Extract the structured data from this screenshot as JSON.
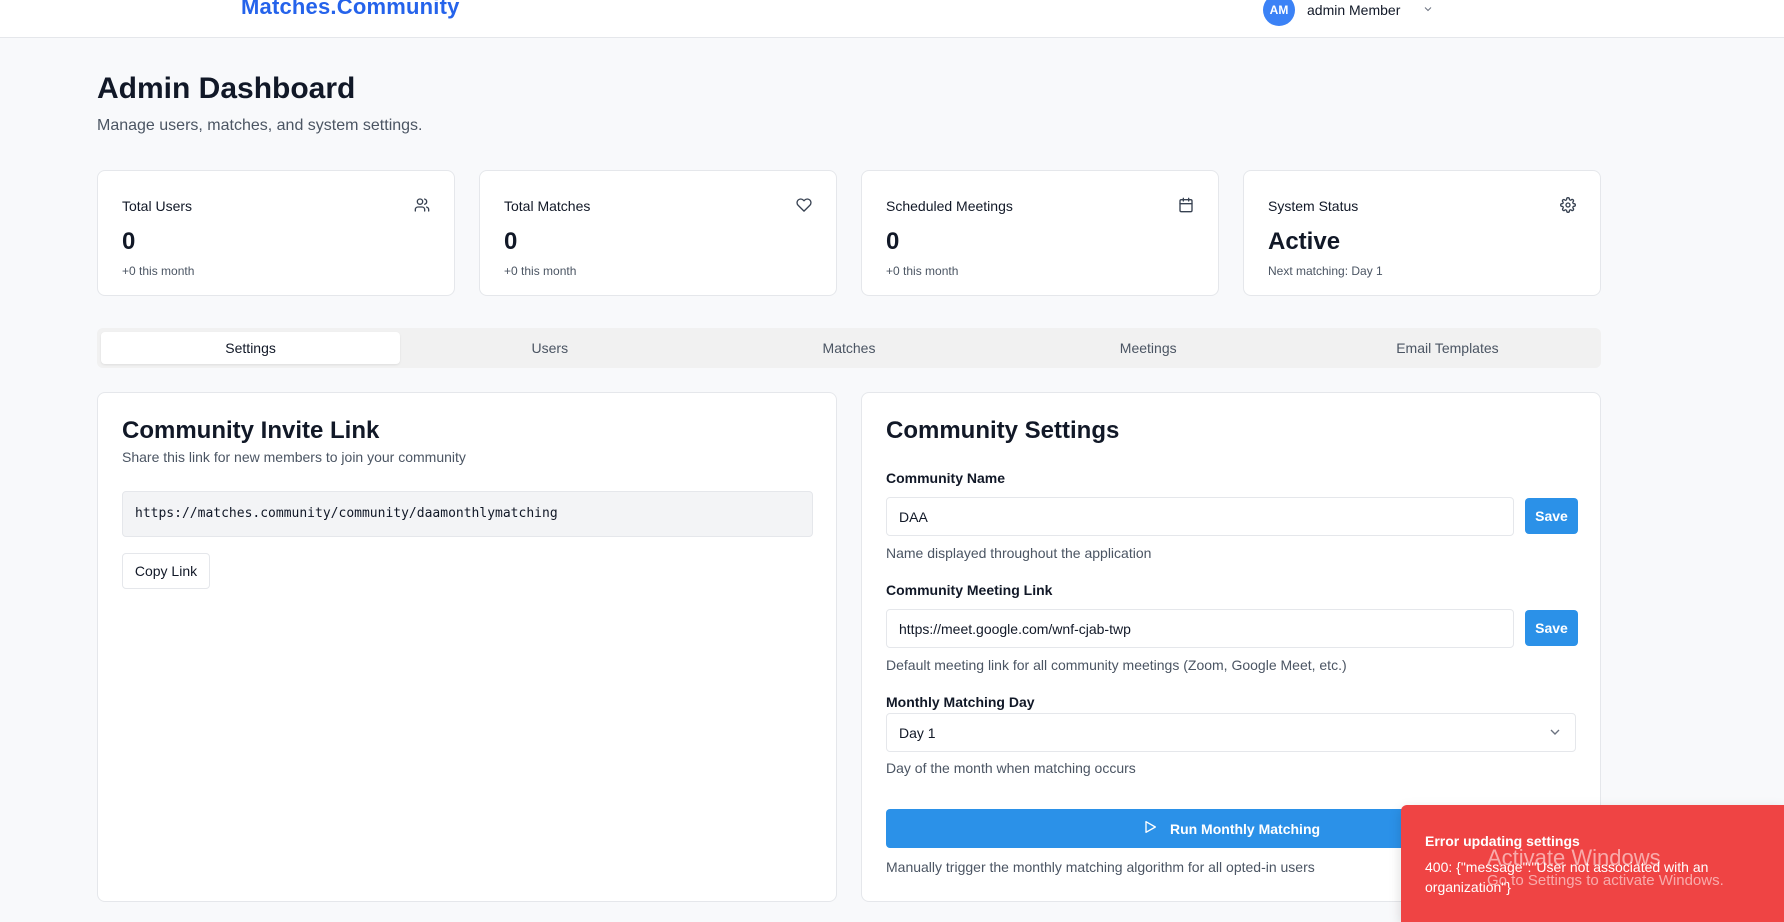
{
  "header": {
    "brand": "Matches.Community",
    "avatar_initials": "AM",
    "user_name": "admin Member"
  },
  "page": {
    "title": "Admin Dashboard",
    "subtitle": "Manage users, matches, and system settings."
  },
  "stats": [
    {
      "label": "Total Users",
      "value": "0",
      "sub": "+0 this month",
      "icon": "users-icon"
    },
    {
      "label": "Total Matches",
      "value": "0",
      "sub": "+0 this month",
      "icon": "heart-icon"
    },
    {
      "label": "Scheduled Meetings",
      "value": "0",
      "sub": "+0 this month",
      "icon": "calendar-icon"
    },
    {
      "label": "System Status",
      "value": "Active",
      "sub": "Next matching: Day 1",
      "icon": "gear-icon"
    }
  ],
  "tabs": [
    {
      "label": "Settings",
      "active": true
    },
    {
      "label": "Users"
    },
    {
      "label": "Matches"
    },
    {
      "label": "Meetings"
    },
    {
      "label": "Email Templates"
    }
  ],
  "invite": {
    "title": "Community Invite Link",
    "description": "Share this link for new members to join your community",
    "link": "https://matches.community/community/daamonthlymatching",
    "copy_label": "Copy Link"
  },
  "settings": {
    "title": "Community Settings",
    "name_label": "Community Name",
    "name_value": "DAA",
    "name_help": "Name displayed throughout the application",
    "save_label": "Save",
    "meeting_label": "Community Meeting Link",
    "meeting_value": "https://meet.google.com/wnf-cjab-twp",
    "meeting_help": "Default meeting link for all community meetings (Zoom, Google Meet, etc.)",
    "day_label": "Monthly Matching Day",
    "day_value": "Day 1",
    "day_help": "Day of the month when matching occurs",
    "run_label": "Run Monthly Matching",
    "run_help": "Manually trigger the monthly matching algorithm for all opted-in users"
  },
  "toast": {
    "title": "Error updating settings",
    "message": "400: {\"message\":\"User not associated with an organization\"}"
  },
  "watermark": {
    "line1": "Activate Windows",
    "line2": "Go to Settings to activate Windows."
  },
  "colors": {
    "brand": "#2563eb",
    "primary_button": "#2b91e8",
    "error_toast": "#ef4444"
  }
}
